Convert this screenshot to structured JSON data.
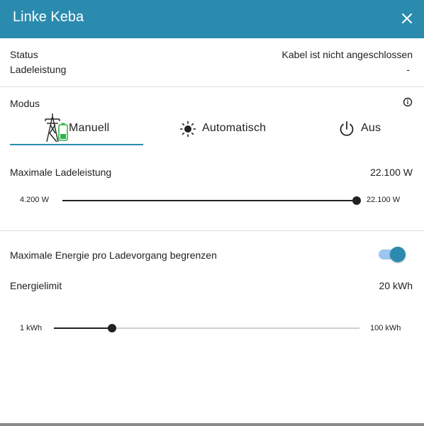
{
  "header": {
    "title": "Linke Keba"
  },
  "status": {
    "status_label": "Status",
    "status_value": "Kabel ist nicht angeschlossen",
    "power_label": "Ladeleistung",
    "power_value": "-"
  },
  "mode": {
    "label": "Modus",
    "tabs": [
      {
        "label": "Manuell",
        "icon": "power-pylon-battery-icon",
        "selected": true
      },
      {
        "label": "Automatisch",
        "icon": "sun-icon",
        "selected": false
      },
      {
        "label": "Aus",
        "icon": "power-icon",
        "selected": false
      }
    ],
    "accent_color": "#2b8bae"
  },
  "max_power": {
    "label": "Maximale Ladeleistung",
    "value": "22.100 W",
    "slider_min": "4.200 W",
    "slider_max": "22.100 W",
    "slider_fraction": 1.0
  },
  "energy_limit_toggle": {
    "label": "Maximale Energie pro Ladevorgang begrenzen",
    "on": true
  },
  "energy_limit": {
    "label": "Energielimit",
    "value": "20 kWh",
    "slider_min": "1 kWh",
    "slider_max": "100 kWh",
    "slider_fraction": 0.19
  },
  "colors": {
    "header": "#2b8bae",
    "toggle_track": "#9cc5ef"
  }
}
